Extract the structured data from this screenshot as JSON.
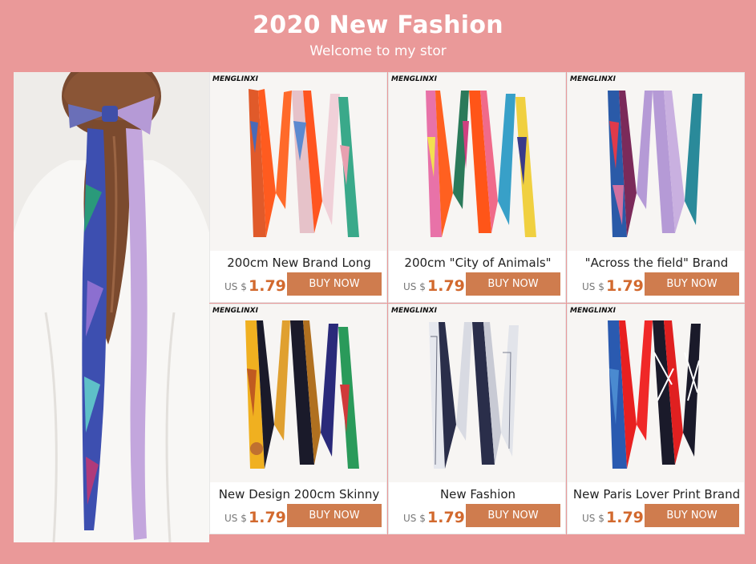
{
  "header": {
    "title": "2020 New Fashion",
    "subtitle": "Welcome to my stor"
  },
  "colors": {
    "background": "#ea9999",
    "price": "#d2692e",
    "button": "#cf7c4e"
  },
  "products": [
    {
      "brand": "MENGLINXI",
      "name": "200cm New Brand Long",
      "currency": "US $",
      "price": "1.79",
      "button": "BUY NOW"
    },
    {
      "brand": "MENGLINXI",
      "name": "200cm \"City of Animals\"",
      "currency": "US $",
      "price": "1.79",
      "button": "BUY NOW"
    },
    {
      "brand": "MENGLINXI",
      "name": "\"Across the field\" Brand",
      "currency": "US $",
      "price": "1.79",
      "button": "BUY NOW"
    },
    {
      "brand": "MENGLINXI",
      "name": "New Design 200cm Skinny",
      "currency": "US $",
      "price": "1.79",
      "button": "BUY NOW"
    },
    {
      "brand": "MENGLINXI",
      "name": "New Fashion",
      "currency": "US $",
      "price": "1.79",
      "button": "BUY NOW"
    },
    {
      "brand": "MENGLINXI",
      "name": "New Paris Lover Print Brand",
      "currency": "US $",
      "price": "1.79",
      "button": "BUY NOW"
    }
  ]
}
